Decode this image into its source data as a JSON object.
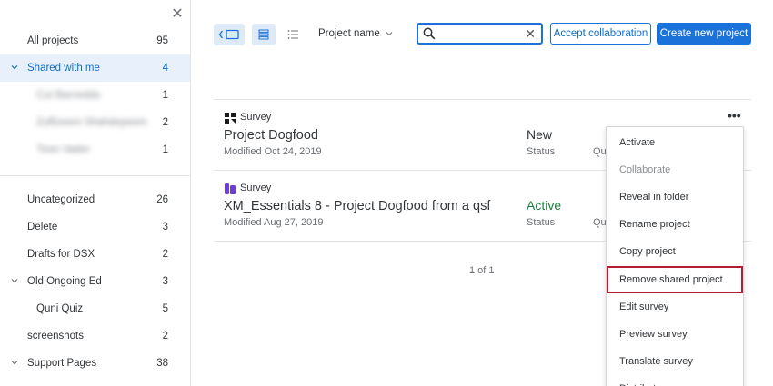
{
  "sidebar": {
    "close_glyph": "✕",
    "all_projects": {
      "label": "All projects",
      "count": "95"
    },
    "shared_with_me": {
      "label": "Shared with me",
      "count": "4"
    },
    "shared_users": [
      {
        "label": "Cut Barnedds",
        "count": "1"
      },
      {
        "label": "Zulfizeem Shahdepeem",
        "count": "2"
      },
      {
        "label": "Tiren Vader",
        "count": "1"
      }
    ],
    "folders": [
      {
        "label": "Uncategorized",
        "count": "26"
      },
      {
        "label": "Delete",
        "count": "3"
      },
      {
        "label": "Drafts for DSX",
        "count": "2"
      },
      {
        "label": "Old Ongoing Ed",
        "count": "3"
      },
      {
        "label": "Quni Quiz",
        "count": "5"
      },
      {
        "label": "screenshots",
        "count": "2"
      },
      {
        "label": "Support Pages",
        "count": "38"
      }
    ]
  },
  "toolbar": {
    "sort_label": "Project name",
    "search_value": "",
    "clear_glyph": "✕",
    "accept_label": "Accept collaboration",
    "create_label": "Create new project"
  },
  "projects": [
    {
      "type": "Survey",
      "name": "Project Dogfood",
      "modified": "Modified Oct 24, 2019",
      "status_value": "New",
      "status_label": "Status",
      "extra_label": "Qu",
      "icon_color": "#1a1a1a"
    },
    {
      "type": "Survey",
      "name": "XM_Essentials 8 - Project Dogfood from a qsf",
      "modified": "Modified Aug 27, 2019",
      "status_value": "Active",
      "status_label": "Status",
      "extra_label": "Qu",
      "icon_color": "#6e3fd6"
    }
  ],
  "more_glyph": "•••",
  "pager": "1 of 1",
  "menu": {
    "items": [
      {
        "label": "Activate"
      },
      {
        "label": "Collaborate"
      },
      {
        "label": "Reveal in folder"
      },
      {
        "label": "Rename project"
      },
      {
        "label": "Copy project"
      },
      {
        "label": "Remove shared project"
      },
      {
        "label": "Edit survey"
      },
      {
        "label": "Preview survey"
      },
      {
        "label": "Translate survey"
      },
      {
        "label": "Distribute survey"
      }
    ],
    "disabled_index": 1,
    "highlighted_index": 5
  },
  "colors": {
    "accent": "#1b72d8",
    "active_status": "#1d7f3e",
    "highlight_border": "#b41d32"
  }
}
